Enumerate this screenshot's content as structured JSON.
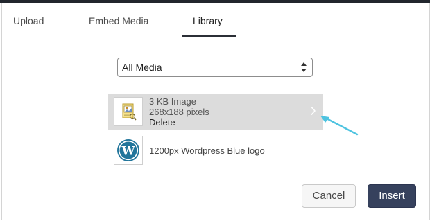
{
  "tabs": [
    {
      "label": "Upload"
    },
    {
      "label": "Embed Media"
    },
    {
      "label": "Library",
      "active": true
    }
  ],
  "filter": {
    "selected": "All Media"
  },
  "media": [
    {
      "title": "3 KB Image",
      "dimensions": "268x188 pixels",
      "delete_label": "Delete",
      "selected": true,
      "icon": "image-document-icon"
    },
    {
      "title": "1200px Wordpress Blue logo",
      "selected": false,
      "icon": "wordpress-logo-icon"
    }
  ],
  "buttons": {
    "cancel": "Cancel",
    "insert": "Insert"
  },
  "colors": {
    "insert_bg": "#36415d",
    "selected_row": "#dcdcdc",
    "annotation_arrow": "#4ec3e0",
    "wordpress_blue": "#21759b"
  }
}
